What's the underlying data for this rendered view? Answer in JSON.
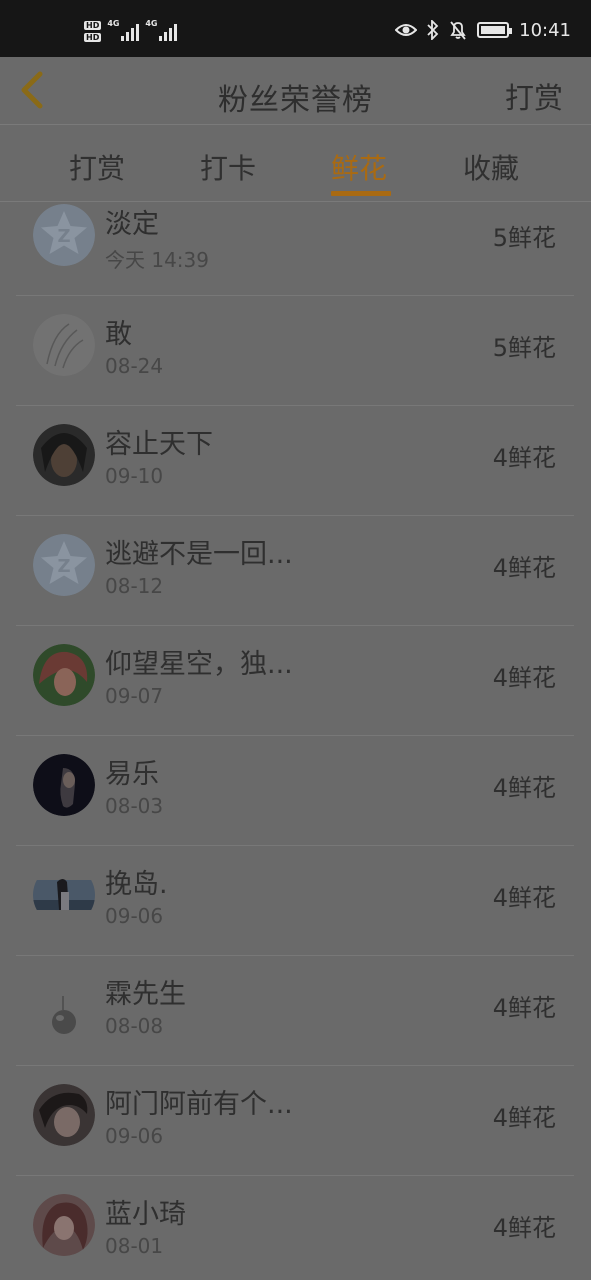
{
  "status_bar": {
    "hd_1": "HD",
    "hd_2": "HD",
    "network_1": "4G",
    "network_2": "4G",
    "time": "10:41"
  },
  "header": {
    "back_icon": "chevron-left-icon",
    "title": "粉丝荣誉榜",
    "action": "打赏"
  },
  "tabs": [
    {
      "label": "打赏",
      "active": false
    },
    {
      "label": "打卡",
      "active": false
    },
    {
      "label": "鲜花",
      "active": true
    },
    {
      "label": "收藏",
      "active": false
    }
  ],
  "accent_color": "#a96a12",
  "fans": [
    {
      "name": "淡定",
      "date": "今天 14:39",
      "count": "5鲜花"
    },
    {
      "name": "敢",
      "date": "08-24",
      "count": "5鲜花"
    },
    {
      "name": "容止天下",
      "date": "09-10",
      "count": "4鲜花"
    },
    {
      "name": "逃避不是一回...",
      "date": "08-12",
      "count": "4鲜花"
    },
    {
      "name": "仰望星空，独...",
      "date": "09-07",
      "count": "4鲜花"
    },
    {
      "name": "易乐",
      "date": "08-03",
      "count": "4鲜花"
    },
    {
      "name": "挽岛.",
      "date": "09-06",
      "count": "4鲜花"
    },
    {
      "name": "霖先生",
      "date": "08-08",
      "count": "4鲜花"
    },
    {
      "name": "阿门阿前有个...",
      "date": "09-06",
      "count": "4鲜花"
    },
    {
      "name": "蓝小琦",
      "date": "08-01",
      "count": "4鲜花"
    }
  ]
}
